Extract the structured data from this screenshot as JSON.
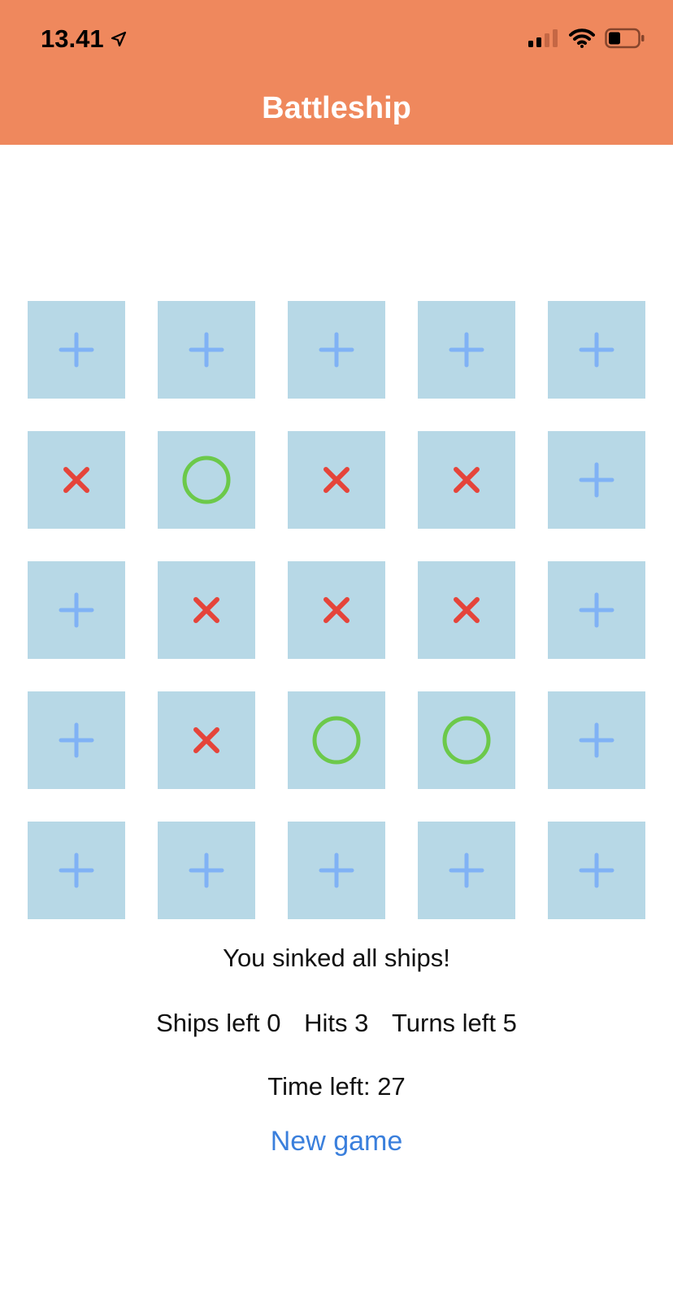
{
  "status_bar": {
    "time": "13.41",
    "location_icon": "location-arrow-icon",
    "signal_icon": "cellular-signal-icon",
    "wifi_icon": "wifi-icon",
    "battery_icon": "battery-icon"
  },
  "header": {
    "title": "Battleship",
    "background_color": "#ef885d"
  },
  "board": {
    "cell_color": "#b7d8e6",
    "legend": {
      "unknown": "plus-icon",
      "miss": "cross-icon",
      "hit": "circle-icon"
    },
    "rows": [
      [
        "unknown",
        "unknown",
        "unknown",
        "unknown",
        "unknown"
      ],
      [
        "miss",
        "hit",
        "miss",
        "miss",
        "unknown"
      ],
      [
        "unknown",
        "miss",
        "miss",
        "miss",
        "unknown"
      ],
      [
        "unknown",
        "miss",
        "hit",
        "hit",
        "unknown"
      ],
      [
        "unknown",
        "unknown",
        "unknown",
        "unknown",
        "unknown"
      ]
    ],
    "colors": {
      "unknown": "#80b2f5",
      "miss": "#e5443a",
      "hit": "#6cc94a"
    }
  },
  "game_info": {
    "message": "You sinked all ships!",
    "ships_left": "Ships left 0",
    "hits": "Hits 3",
    "turns_left": "Turns left 5",
    "time_left": "Time left: 27"
  },
  "actions": {
    "new_game_label": "New game",
    "link_color": "#3a7fdc"
  }
}
